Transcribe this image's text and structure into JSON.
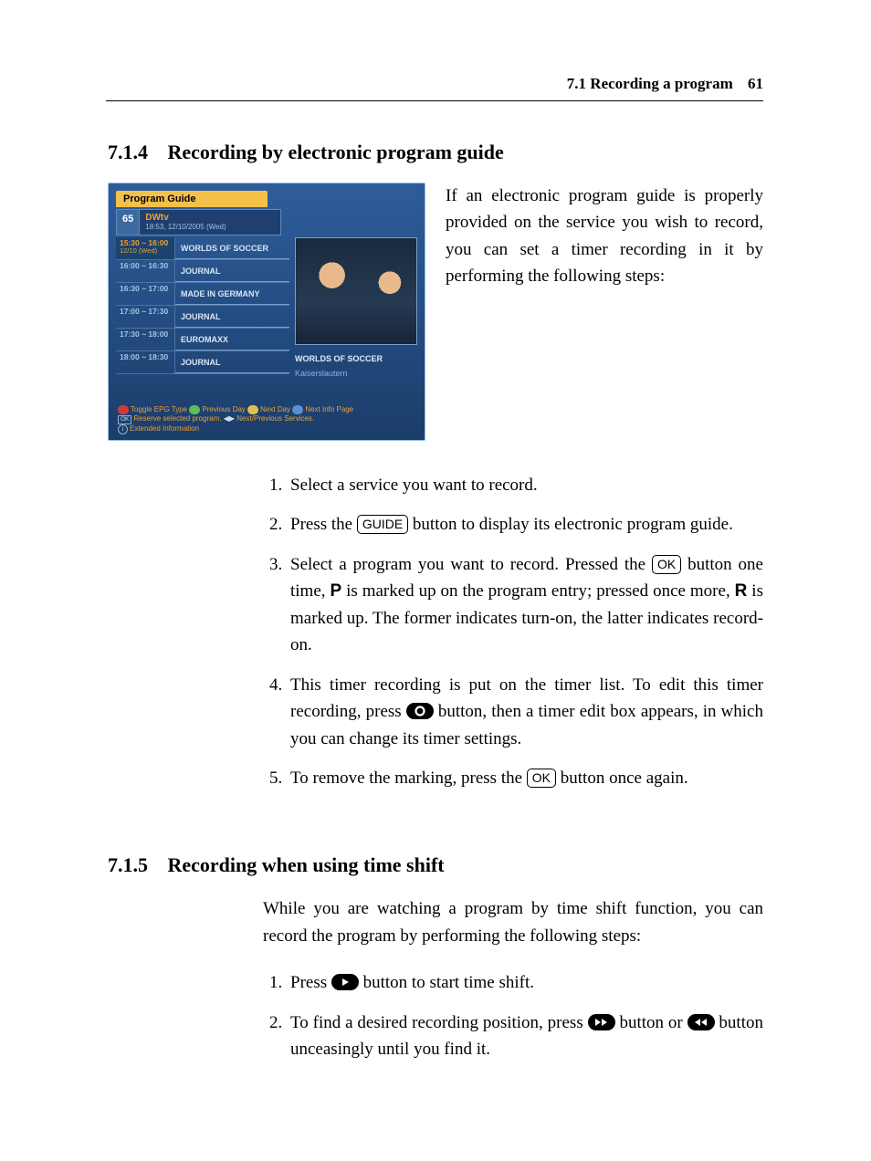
{
  "header": {
    "section_ref": "7.1 Recording a program",
    "page_no": "61"
  },
  "sec_714": {
    "num": "7.1.4",
    "title": "Recording by electronic program guide"
  },
  "sec_715": {
    "num": "7.1.5",
    "title": "Recording when using time shift"
  },
  "intro_714": "If an electronic program guide is properly provided on the service you wish to record, you can set a timer recording in it by performing the following steps:",
  "intro_715": "While you are watching a program by time shift function, you can record the program by performing the following steps:",
  "steps_714": {
    "s1": "Select a service you want to record.",
    "s2_a": "Press the ",
    "s2_b": " button to display its electronic program guide.",
    "s3_a": "Select a program you want to record.  Pressed the ",
    "s3_b": " button one time, ",
    "s3_c": " is marked up on the program entry; pressed once more, ",
    "s3_d": " is marked up.  The former indicates turn-on, the latter indicates record-on.",
    "s4_a": "This timer recording is put on the timer list. To edit this timer recording, press ",
    "s4_b": " button, then a timer edit box appears, in which you can change its timer settings.",
    "s5_a": "To remove the marking, press the ",
    "s5_b": " button once again."
  },
  "steps_715": {
    "s1_a": "Press ",
    "s1_b": " button to start time shift.",
    "s2_a": "To find a desired recording position, press ",
    "s2_b": " button or ",
    "s2_c": " button unceasingly until you find it."
  },
  "keys": {
    "guide": "GUIDE",
    "ok": "OK",
    "p": "P",
    "r": "R"
  },
  "epg": {
    "title": "Program Guide",
    "ch_num": "65",
    "ch_name": "DWtv",
    "ch_time": "18:53, 12/10/2005 (Wed)",
    "rows": [
      {
        "time": "15:30 ~ 16:00",
        "sub": "12/10 (Wed)",
        "prog": "WORLDS OF SOCCER",
        "sel": true
      },
      {
        "time": "16:00 ~ 16:30",
        "prog": "JOURNAL"
      },
      {
        "time": "16:30 ~ 17:00",
        "prog": "MADE IN GERMANY"
      },
      {
        "time": "17:00 ~ 17:30",
        "prog": "JOURNAL"
      },
      {
        "time": "17:30 ~ 18:00",
        "prog": "EUROMAXX"
      },
      {
        "time": "18:00 ~ 18:30",
        "prog": "JOURNAL"
      }
    ],
    "preview_title": "WORLDS OF SOCCER",
    "preview_sub": "Kaiserslautern",
    "legend": {
      "l1_a": "Toggle EPG Type",
      "l1_b": "Previous Day",
      "l1_c": "Next Day",
      "l1_d": "Next Info Page",
      "l2_a": "Reserve selected program.",
      "l2_b": "Next/Previous Services.",
      "l3": "Extended Information"
    }
  }
}
